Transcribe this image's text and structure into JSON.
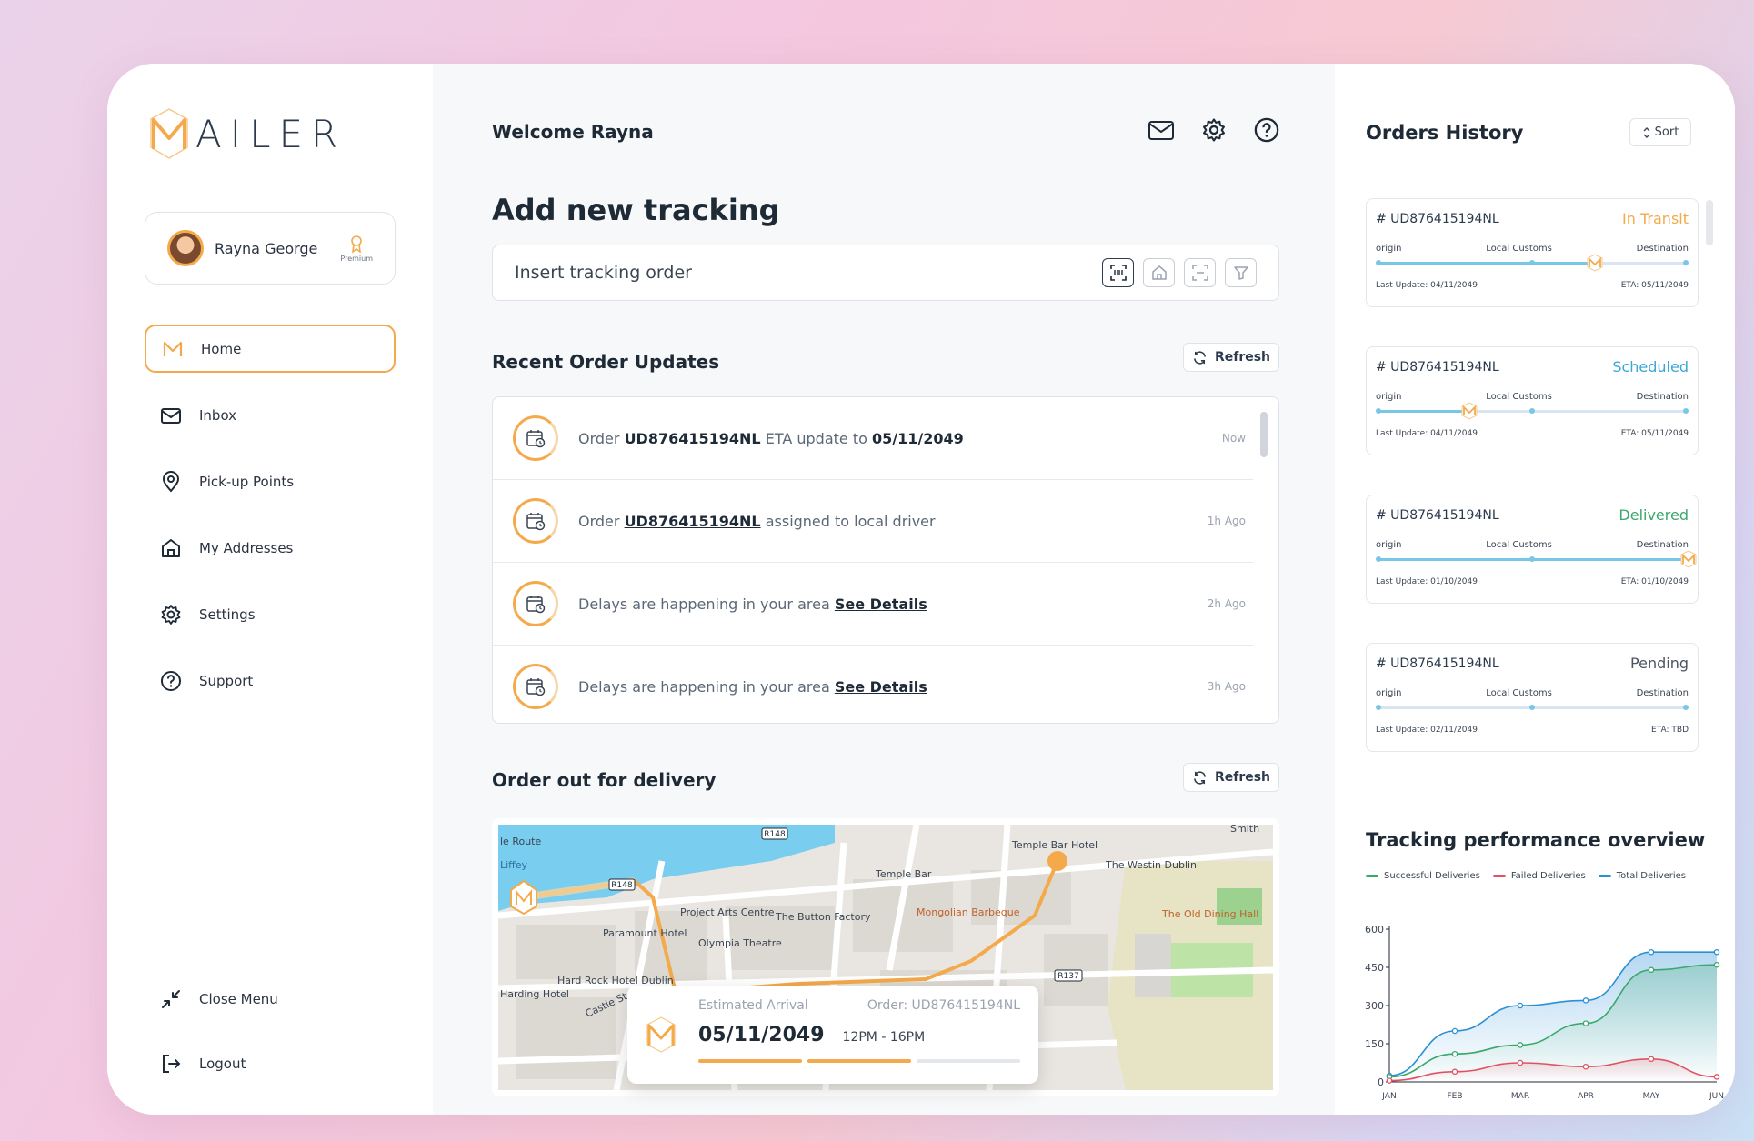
{
  "brand": {
    "name": "AILER",
    "accent": "#f4a94a"
  },
  "user": {
    "name": "Rayna George",
    "tier": "Premium"
  },
  "nav": [
    {
      "label": "Home",
      "icon": "mailer-logo-icon",
      "active": true
    },
    {
      "label": "Inbox",
      "icon": "mail-icon"
    },
    {
      "label": "Pick-up Points",
      "icon": "map-pin-icon"
    },
    {
      "label": "My Addresses",
      "icon": "home-icon"
    },
    {
      "label": "Settings",
      "icon": "gear-icon"
    },
    {
      "label": "Support",
      "icon": "help-icon"
    }
  ],
  "nav_bottom": [
    {
      "label": "Close Menu",
      "icon": "collapse-icon"
    },
    {
      "label": "Logout",
      "icon": "logout-icon"
    }
  ],
  "header": {
    "welcome": "Welcome Rayna"
  },
  "tracking": {
    "title": "Add new tracking",
    "placeholder": "Insert tracking order"
  },
  "recent": {
    "title": "Recent Order Updates",
    "refresh_label": "Refresh",
    "items": [
      {
        "pre": "Order ",
        "link": "UD876415194NL",
        "mid": " ETA update to ",
        "bold": "05/11/2049",
        "time": "Now"
      },
      {
        "pre": "Order ",
        "link": "UD876415194NL",
        "mid": " assigned to local driver",
        "bold": "",
        "time": "1h Ago"
      },
      {
        "pre": "Delays are happening in your area ",
        "link": "See Details",
        "mid": "",
        "bold": "",
        "time": "2h Ago"
      },
      {
        "pre": "Delays are happening in your area ",
        "link": "See Details",
        "mid": "",
        "bold": "",
        "time": "3h Ago"
      }
    ]
  },
  "delivery": {
    "title": "Order out for delivery",
    "refresh_label": "Refresh",
    "map_labels": {
      "liffey": "Liffey",
      "route": "le Route",
      "r148a": "R148",
      "r148b": "R148",
      "r137": "R137",
      "temple_bar_hotel": "Temple Bar Hotel",
      "temple_bar": "Temple Bar",
      "westin": "The Westin Dublin",
      "project_arts": "Project Arts Centre",
      "button_factory": "The Button Factory",
      "mongolian": "Mongolian Barbeque",
      "old_dining": "The Old Dining Hall",
      "paramount": "Paramount Hotel",
      "olympia": "Olympia Theatre",
      "hard_rock": "Hard Rock Hotel Dublin",
      "harding": "Harding Hotel",
      "castle_st": "Castle St",
      "smith": "Smith"
    },
    "arrival": {
      "label": "Estimated Arrival",
      "order": "Order: UD876415194NL",
      "date": "05/11/2049",
      "window": "12PM - 16PM"
    }
  },
  "orders_history": {
    "title": "Orders History",
    "sort_label": "Sort",
    "labels": {
      "origin": "origin",
      "customs": "Local Customs",
      "destination": "Destination"
    },
    "cards": [
      {
        "id": "# UD876415194NL",
        "status": "In Transit",
        "status_color": "#f4a94a",
        "progress": 0.7,
        "last_update": "Last Update: 04/11/2049",
        "eta": "ETA: 05/11/2049"
      },
      {
        "id": "# UD876415194NL",
        "status": "Scheduled",
        "status_color": "#3aa6d9",
        "progress": 0.3,
        "last_update": "Last Update: 04/11/2049",
        "eta": "ETA: 05/11/2049"
      },
      {
        "id": "# UD876415194NL",
        "status": "Delivered",
        "status_color": "#3aa86b",
        "progress": 1.0,
        "last_update": "Last Update: 01/10/2049",
        "eta": "ETA: 01/10/2049"
      },
      {
        "id": "# UD876415194NL",
        "status": "Pending",
        "status_color": "#4b5563",
        "progress": 0.0,
        "last_update": "Last Update: 02/11/2049",
        "eta": "ETA: TBD"
      }
    ]
  },
  "chart_data": {
    "type": "line",
    "title": "Tracking performance overview",
    "categories": [
      "JAN",
      "FEB",
      "MAR",
      "APR",
      "MAY",
      "JUN"
    ],
    "yticks": [
      0,
      150,
      300,
      450,
      600
    ],
    "ylim": [
      0,
      600
    ],
    "series": [
      {
        "name": "Successful Deliveries",
        "color": "#3aa86b",
        "values": [
          20,
          110,
          145,
          230,
          440,
          460
        ]
      },
      {
        "name": "Failed Deliveries",
        "color": "#e05263",
        "values": [
          5,
          40,
          75,
          60,
          90,
          20
        ]
      },
      {
        "name": "Total Deliveries",
        "color": "#2b8fd6",
        "values": [
          25,
          200,
          300,
          320,
          510,
          510
        ]
      }
    ],
    "legend": "top"
  }
}
